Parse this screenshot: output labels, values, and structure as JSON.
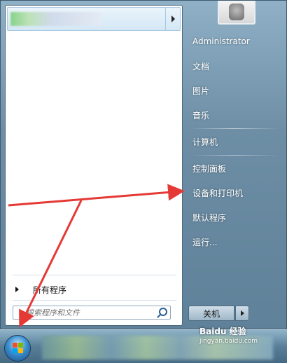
{
  "start_menu": {
    "all_programs_label": "所有程序",
    "search": {
      "placeholder": "搜索程序和文件",
      "icon": "search-icon"
    },
    "right_items": [
      "Administrator",
      "文档",
      "图片",
      "音乐",
      "计算机",
      "控制面板",
      "设备和打印机",
      "默认程序",
      "运行..."
    ],
    "shutdown_label": "关机"
  },
  "watermark": {
    "brand": "Baidu 经验",
    "url": "jingyan.baidu.com"
  },
  "colors": {
    "arrow": "#e53935",
    "right_text": "#ffffff"
  }
}
